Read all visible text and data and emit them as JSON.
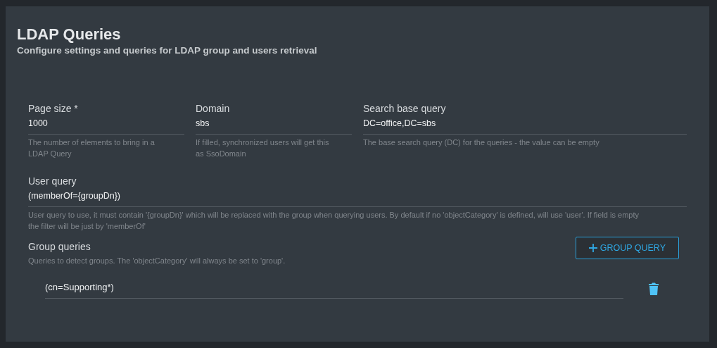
{
  "header": {
    "title": "LDAP Queries",
    "subtitle": "Configure settings and queries for LDAP group and users retrieval"
  },
  "fields": [
    {
      "label": "Page size *",
      "value": "1000",
      "helper": "The number of elements to bring in a LDAP Query"
    },
    {
      "label": "Domain",
      "value": "sbs",
      "helper": "If filled, synchronized users will get this as SsoDomain"
    },
    {
      "label": "Search base query",
      "value": "DC=office,DC=sbs",
      "helper": "The base search query (DC) for the queries - the value can be empty"
    }
  ],
  "user_query": {
    "label": "User query",
    "value": "(memberOf={groupDn})",
    "helper": "User query to use, it must contain '{groupDn}' which will be replaced with the group when querying users. By default if no 'objectCategory' is defined, will use 'user'. If field is empty the filter will be just by 'memberOf'"
  },
  "group_queries": {
    "title": "Group queries",
    "description": "Queries to detect groups. The 'objectCategory' will always be set to 'group'.",
    "add_button": "GROUP QUERY",
    "items": [
      {
        "value": "(cn=Supporting*)"
      }
    ]
  }
}
